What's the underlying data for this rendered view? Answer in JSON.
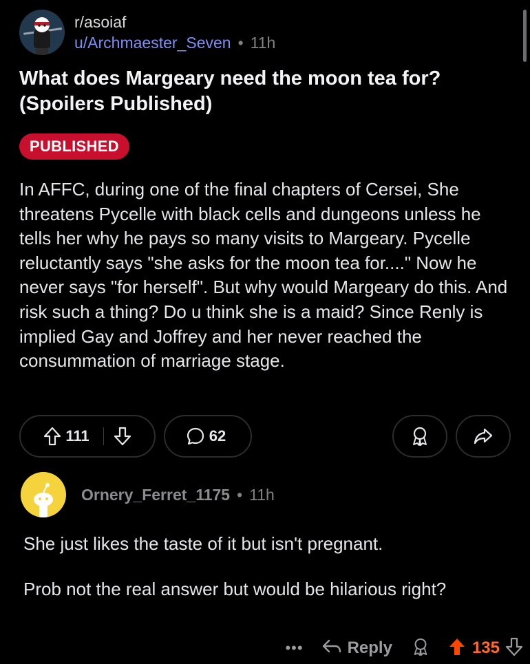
{
  "post": {
    "subreddit": "r/asoiaf",
    "author": "u/Archmaester_Seven",
    "separator": "•",
    "time": "11h",
    "title": "What does Margeary need the moon tea for? (Spoilers Published)",
    "flair": "PUBLISHED",
    "flair_color": "#c8102e",
    "body": "In AFFC, during one of the final chapters of Cersei, She threatens Pycelle with black cells and dungeons unless he tells her why he pays so many visits to Margeary. Pycelle reluctantly says \"she asks for the moon tea for....\" Now he never says \"for herself\". But why would Margeary do this. And risk such a thing? Do u think she is a maid? Since Renly is implied Gay and Joffrey and her never reached the consummation of marriage stage.",
    "upvotes": "111",
    "comments": "62",
    "icons": {
      "upvote": "arrow-up-icon",
      "downvote": "arrow-down-icon",
      "comment": "comment-bubble-icon",
      "award": "award-icon",
      "share": "share-arrow-icon"
    }
  },
  "comment": {
    "author": "Ornery_Ferret_1175",
    "separator": "•",
    "time": "11h",
    "paragraph1": "She just likes the taste of it but isn't pregnant.",
    "paragraph2": "Prob not the real answer but would be hilarious right?",
    "more": "•••",
    "reply_label": "Reply",
    "score": "135",
    "score_color": "#ff6a2e",
    "avatar_color": "#f5d33c"
  }
}
